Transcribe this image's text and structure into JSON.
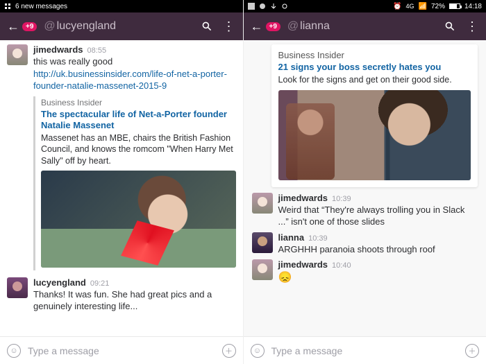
{
  "left": {
    "statusbar": {
      "text": "6 new messages"
    },
    "header": {
      "badge": "+9",
      "channel": "lucyengland"
    },
    "messages": [
      {
        "user": "jimedwards",
        "time": "08:55",
        "text_pre": "this was really good ",
        "link": "http://uk.businessinsider.com/life-of-net-a-porter-founder-natalie-massenet-2015-9",
        "attachment": {
          "site": "Business Insider",
          "title": "The spectacular life of Net-a-Porter founder Natalie Massenet",
          "desc": "Massenet has an MBE, chairs the British Fashion Council, and knows the romcom \"When Harry Met Sally\" off by heart."
        }
      },
      {
        "user": "lucyengland",
        "time": "09:21",
        "text": "Thanks! It was fun. She had great pics and a genuinely interesting life..."
      }
    ],
    "composer": {
      "placeholder": "Type a message"
    }
  },
  "right": {
    "statusbar": {
      "net": "4G",
      "battery": "72%",
      "clock": "14:18"
    },
    "header": {
      "badge": "+9",
      "channel": "lianna"
    },
    "card": {
      "site": "Business Insider",
      "title": "21 signs your boss secretly hates you",
      "desc": "Look for the signs and get on their good side."
    },
    "messages": [
      {
        "user": "jimedwards",
        "time": "10:39",
        "text": "Weird that “They're always trolling you in Slack ...” isn't one of those slides"
      },
      {
        "user": "lianna",
        "time": "10:39",
        "text": "ARGHHH paranoia shoots through roof"
      },
      {
        "user": "jimedwards",
        "time": "10:40",
        "emoji": "😞"
      }
    ],
    "composer": {
      "placeholder": "Type a message"
    }
  }
}
